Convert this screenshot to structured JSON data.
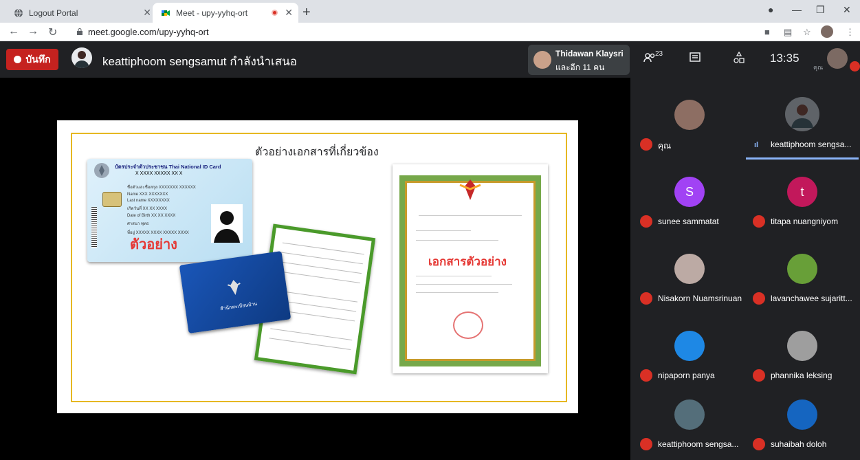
{
  "browser": {
    "tabs": [
      {
        "title": "Logout Portal",
        "icon": "globe-icon"
      },
      {
        "title": "Meet - upy-yyhq-ort",
        "icon": "google-meet-icon",
        "recording": true
      }
    ],
    "url": "meet.google.com/upy-yyhq-ort"
  },
  "meet": {
    "record_label": "บันทึก",
    "presenter_text": "keattiphoom sengsamut กำลังนำเสนอ",
    "viewer_name": "Thidawan Klaysri",
    "viewer_more": "และอีก 11 คน",
    "people_count": "23",
    "time": "13:35",
    "self_label": "คุณ"
  },
  "slide": {
    "title": "ตัวอย่างเอกสารที่เกี่ยวข้อง",
    "id_card_header": "บัตรประจำตัวประชาชน Thai National ID Card",
    "id_card_number": "X XXXX XXXXX XX X",
    "id_card_lines": [
      "ชื่อตัวและชื่อสกุล XXXXXXX XXXXXX",
      "Name XXX XXXXXXX",
      "Last name XXXXXXXX",
      "เกิดวันที่ XX XX XXXX",
      "Date of Birth XX XX XXXX",
      "ศาสนา พุทธ",
      "ที่อยู่ XXXXX XXXX XXXXX XXXX"
    ],
    "id_card_sample": "ตัวอย่าง",
    "passbook_label": "สำนักทะเบียนบ้าน",
    "cert_sample": "เอกสารตัวอย่าง"
  },
  "participants": [
    {
      "name": "คุณ",
      "avatar_color": "#8d6e63",
      "muted": true
    },
    {
      "name": "keattiphoom sengsa...",
      "avatar_color": "#5f6368",
      "speaking": true
    },
    {
      "name": "sunee sammatat",
      "initial": "S",
      "avatar_color": "#a142f4",
      "muted": true
    },
    {
      "name": "titapa nuangniyom",
      "initial": "t",
      "avatar_color": "#c2185b",
      "muted": true
    },
    {
      "name": "Nisakorn Nuamsrinuan",
      "avatar_color": "#bcaaa4",
      "muted": true
    },
    {
      "name": "lavanchawee sujaritt...",
      "avatar_color": "#689f38",
      "muted": true
    },
    {
      "name": "nipaporn panya",
      "avatar_color": "#1e88e5",
      "muted": true
    },
    {
      "name": "phannika leksing",
      "avatar_color": "#9e9e9e",
      "muted": true
    },
    {
      "name": "keattiphoom sengsa...",
      "avatar_color": "#546e7a",
      "muted": true
    },
    {
      "name": "suhaibah doloh",
      "avatar_color": "#1565c0",
      "muted": true
    }
  ]
}
